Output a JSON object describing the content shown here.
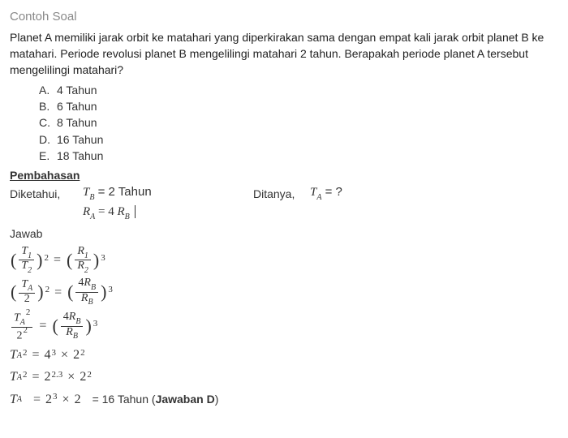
{
  "title": "Contoh Soal",
  "question": "Planet A memiliki jarak orbit ke matahari yang diperkirakan sama dengan empat kali jarak orbit planet B ke matahari. Periode revolusi planet B mengelilingi matahari 2 tahun. Berapakah periode planet A tersebut mengelilingi matahari?",
  "options": [
    {
      "letter": "A.",
      "text": "4 Tahun"
    },
    {
      "letter": "B.",
      "text": "6 Tahun"
    },
    {
      "letter": "C.",
      "text": "8 Tahun"
    },
    {
      "letter": "D.",
      "text": "16 Tahun"
    },
    {
      "letter": "E.",
      "text": "18 Tahun"
    }
  ],
  "section_pembahasan": "Pembahasan",
  "known_label": "Diketahui,",
  "known1_lhs": "T",
  "known1_sub": "B",
  "known1_rhs": " = 2 Tahun",
  "known2_lhs": "R",
  "known2_subA": "A",
  "known2_mid": " = 4 ",
  "known2_rhs": "R",
  "known2_subB": "B",
  "ask_label": "Ditanya,",
  "ask_lhs": "T",
  "ask_sub": "A",
  "ask_rhs": " = ?",
  "jawab": "Jawab",
  "eq1": {
    "T1": "T",
    "T1s": "1",
    "T2": "T",
    "T2s": "2",
    "R1": "R",
    "R1s": "1",
    "R2": "R",
    "R2s": "2",
    "p2": "2",
    "p3": "3"
  },
  "eq2": {
    "TA": "T",
    "TAs": "A",
    "d2": "2",
    "n4R": "4R",
    "n4Rs": "B",
    "RB": "R",
    "RBs": "B",
    "p2": "2",
    "p3": "3"
  },
  "eq3": {
    "TA": "T",
    "TAs": "A",
    "TAp": "2",
    "d2": "2",
    "d2p": "2",
    "n4R": "4R",
    "n4Rs": "B",
    "RB": "R",
    "RBs": "B",
    "p3": "3"
  },
  "eq4": {
    "TA": "T",
    "TAs": "A",
    "p2": "2",
    "r1": "4",
    "r1p": "3",
    "times": "×",
    "r2": "2",
    "r2p": "2"
  },
  "eq5": {
    "TA": "T",
    "TAs": "A",
    "p2": "2",
    "b": "2",
    "bp": "2.3",
    "times": "×",
    "c": "2",
    "cp": "2"
  },
  "eq6": {
    "TA": "T",
    "TAs": "A",
    "b": "2",
    "bp": "3",
    "times": "×",
    "c": "2"
  },
  "final_eq": "= 16 Tahun (",
  "final_bold": "Jawaban D",
  "final_close": ")"
}
